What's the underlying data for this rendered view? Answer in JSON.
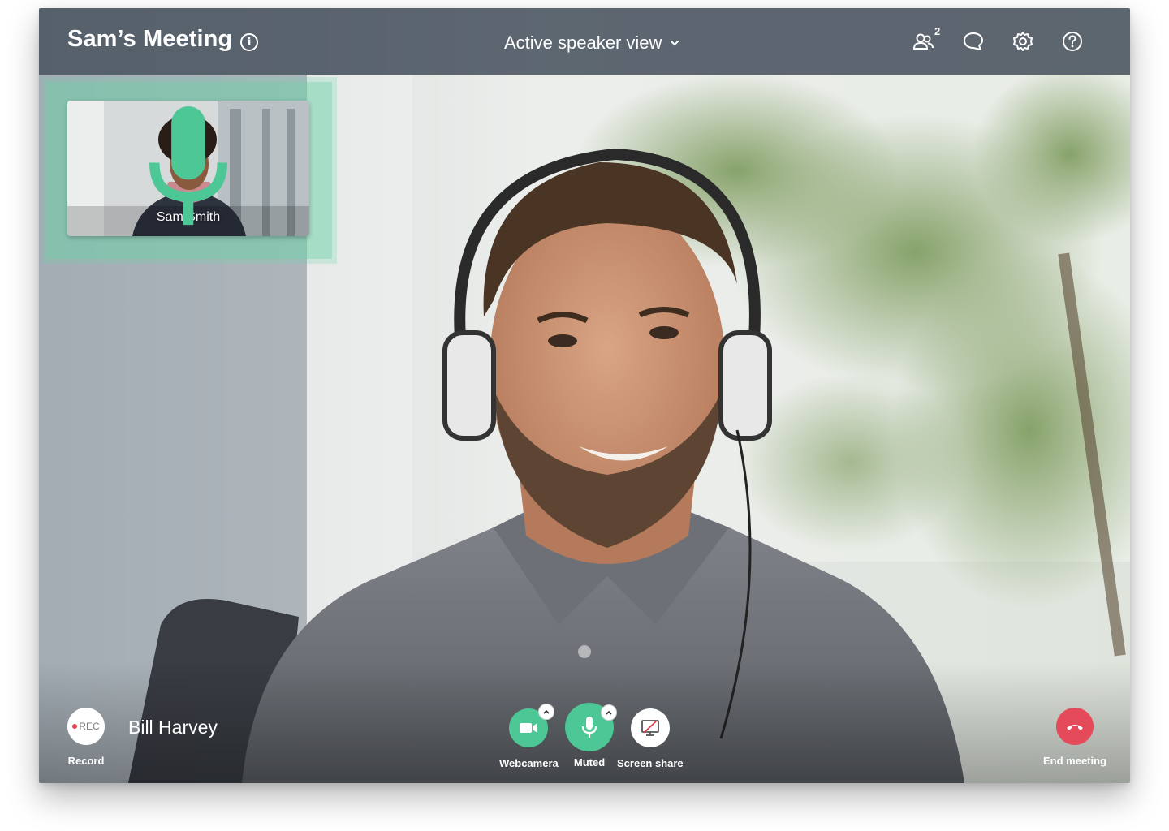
{
  "header": {
    "title": "Sam’s Meeting",
    "info_icon": "info-icon",
    "view_selector": {
      "label": "Active speaker view",
      "icon": "chevron-down-icon"
    },
    "participants": {
      "icon": "participants-icon",
      "count": "2"
    },
    "chat_icon": "chat-icon",
    "settings_icon": "gear-icon",
    "help_icon": "help-icon"
  },
  "self_view": {
    "name": "Sam Smith",
    "mic_status_icon": "microphone-icon",
    "highlight_color": "#6ed2aa"
  },
  "active_speaker": {
    "name": "Bill Harvey"
  },
  "controls": {
    "record": {
      "badge": "REC",
      "label": "Record"
    },
    "webcam": {
      "label": "Webcamera",
      "icon": "video-camera-icon",
      "options_icon": "chevron-up-icon"
    },
    "mic": {
      "label": "Muted",
      "icon": "microphone-icon",
      "options_icon": "chevron-up-icon"
    },
    "screen_share": {
      "label": "Screen share",
      "icon": "screen-share-off-icon"
    },
    "end_meeting": {
      "label": "End meeting",
      "icon": "hang-up-icon"
    }
  },
  "colors": {
    "accent_green": "#4ec796",
    "end_red": "#e44a5a",
    "topbar": "#4a5460",
    "rec_dot": "#e0414d"
  }
}
